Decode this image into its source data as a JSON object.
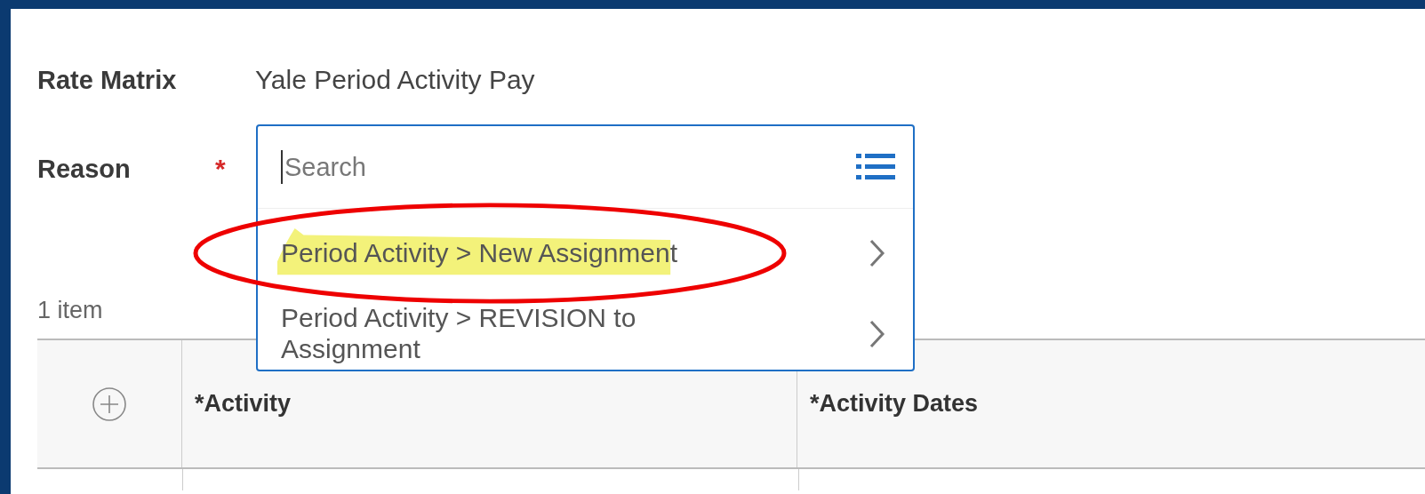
{
  "fields": [
    {
      "label": "Rate Matrix",
      "value": "Yale Period Activity Pay"
    },
    {
      "label": "Reason",
      "required_mark": "*"
    }
  ],
  "dropdown": {
    "placeholder": "Search",
    "options": [
      {
        "label": "Period Activity > New Assignment",
        "highlighted": true,
        "circled": true
      },
      {
        "label": "Period Activity > REVISION to Assignment",
        "highlighted": false,
        "circled": false
      }
    ]
  },
  "item_count": "1 item",
  "table": {
    "columns": [
      {
        "kind": "add"
      },
      {
        "kind": "text",
        "label": "*Activity"
      },
      {
        "kind": "text",
        "label": "*Activity Dates"
      }
    ]
  }
}
